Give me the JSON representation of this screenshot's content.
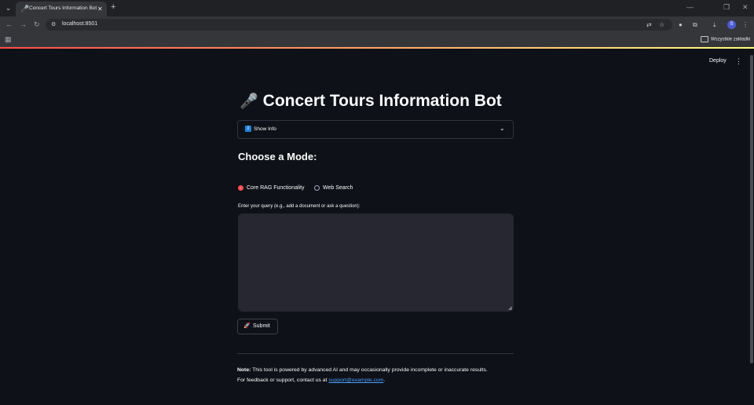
{
  "browser": {
    "tab_title": "Concert Tours Information Bot",
    "tab_favicon": "🎤",
    "tab_close": "✕",
    "new_tab": "+",
    "url": "localhost:8501",
    "bookmark_folder": "Wszystkie zakładki",
    "profile_initial": "S"
  },
  "header": {
    "deploy_label": "Deploy",
    "menu_icon": "⋮"
  },
  "main": {
    "title_emoji": "🎤",
    "title": "Concert Tours Information Bot",
    "expander": {
      "icon": "i",
      "label": "Show Info",
      "chevron": "⌄"
    },
    "mode_heading": "Choose a Mode:",
    "modes": [
      {
        "label": "Core RAG Functionality",
        "selected": true
      },
      {
        "label": "Web Search",
        "selected": false
      }
    ],
    "query_label": "Enter your query (e.g., add a document or ask a question):",
    "query_value": "",
    "submit_emoji": "🚀",
    "submit_label": "Submit",
    "note_bold": "Note:",
    "note_text": " This tool is powered by advanced AI and may occasionally provide incomplete or inaccurate results.",
    "feedback_text": "For feedback or support, contact us at ",
    "support_email": "support@example.com",
    "feedback_end": "."
  },
  "colors": {
    "background": "#0e1117",
    "accent": "#ff4b4b",
    "link": "#4a9eff",
    "info_blue": "#1c83e1",
    "textarea_bg": "#262730"
  }
}
